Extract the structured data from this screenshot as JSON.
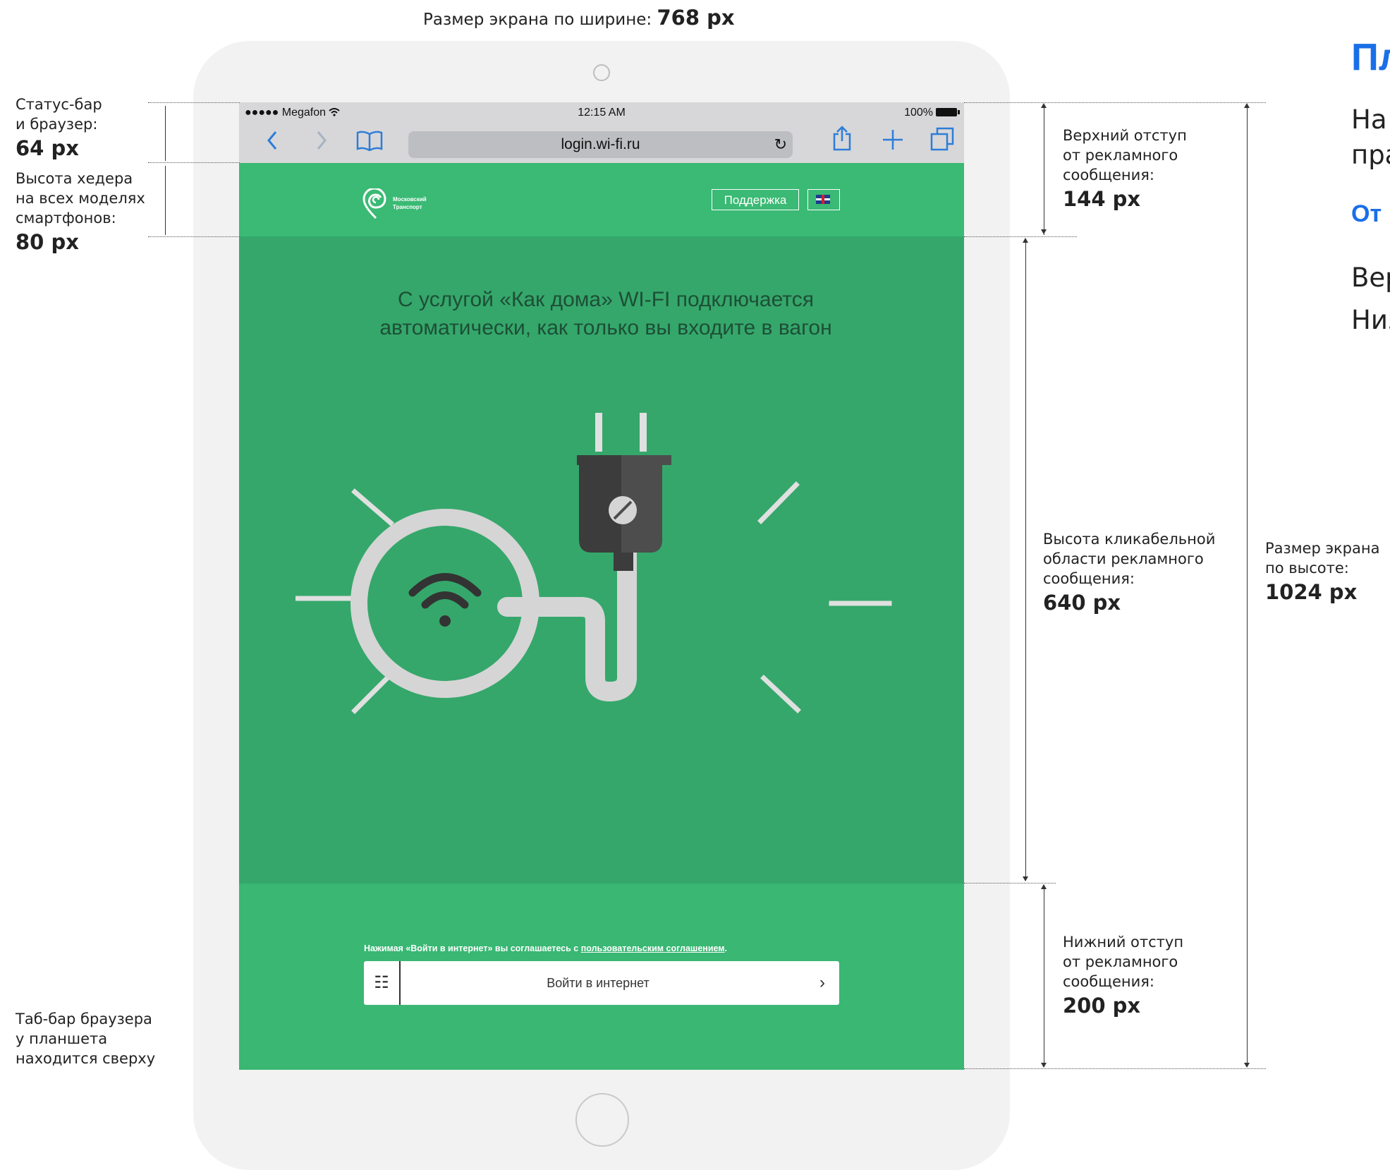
{
  "page_top_label": {
    "text": "Размер экрана по ширине:",
    "value": "768 px"
  },
  "left_notes": [
    {
      "text": "Статус-бар\nи браузер:",
      "value": "64 px"
    },
    {
      "text": "Высота хедера\nна всех моделях\nсмартфонов:",
      "value": "80 px"
    },
    {
      "text": "Таб-бар браузера\nу планшета\nнаходится сверху",
      "value": ""
    }
  ],
  "right_notes": [
    {
      "text": "Верхний отступ\nот рекламного\nсообщения:",
      "value": "144 px"
    },
    {
      "text": "Высота кликабельной\nобласти рекламного\nсообщения:",
      "value": "640 px"
    },
    {
      "text": "Нижний отступ\nот рекламного\nсообщения:",
      "value": "200 px"
    },
    {
      "text": "Размер экрана\nпо высоте:",
      "value": "1024 px"
    }
  ],
  "cut_right": {
    "heading": "Пл",
    "line1": "На",
    "line2": "пра",
    "sub": "От",
    "line3": "Вер",
    "line4": "Низ"
  },
  "status_bar": {
    "carrier": "●●●●● Megafon",
    "time": "12:15 AM",
    "battery": "100%"
  },
  "browser": {
    "url": "login.wi-fi.ru"
  },
  "site": {
    "logo_line1": "Московский",
    "logo_line2": "Транспорт",
    "support_label": "Поддержка",
    "ad_text": "С услугой «Как дома» WI-FI подключается автоматически, как только вы входите в вагон",
    "agreement_prefix": "Нажимая «Войти в интернет» вы соглашаетесь с ",
    "agreement_link": "пользовательским соглашением",
    "agreement_suffix": ".",
    "login_label": "Войти в интернет"
  },
  "colors": {
    "accent_green": "#39b773",
    "ad_green": "#35a76b",
    "ios_blue": "#2d7dd8",
    "brand_blue": "#1a6fe8"
  },
  "icons": [
    "wifi-icon",
    "back-icon",
    "forward-icon",
    "bookmarks-icon",
    "reload-icon",
    "share-icon",
    "add-tab-icon",
    "tabs-icon",
    "plug-icon",
    "uk-flag-icon",
    "chevron-right-icon"
  ]
}
